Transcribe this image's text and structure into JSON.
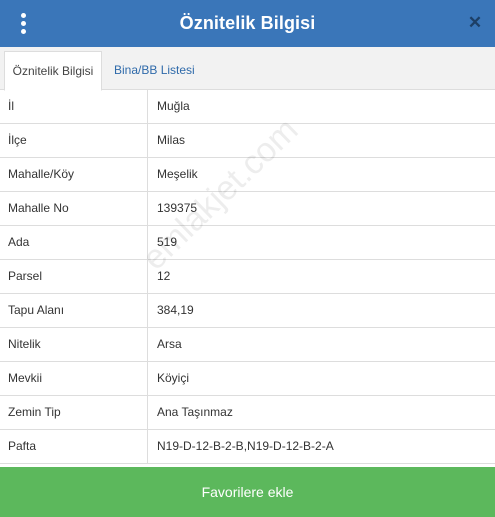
{
  "header": {
    "title": "Öznitelik Bilgisi",
    "close_symbol": "✕"
  },
  "tabs": [
    {
      "label": "Öznitelik Bilgisi",
      "active": true
    },
    {
      "label": "Bina/BB Listesi",
      "active": false
    }
  ],
  "attributes": [
    {
      "label": "İl",
      "value": "Muğla"
    },
    {
      "label": "İlçe",
      "value": "Milas"
    },
    {
      "label": "Mahalle/Köy",
      "value": "Meşelik"
    },
    {
      "label": "Mahalle No",
      "value": "139375"
    },
    {
      "label": "Ada",
      "value": "519"
    },
    {
      "label": "Parsel",
      "value": "12"
    },
    {
      "label": "Tapu Alanı",
      "value": "384,19"
    },
    {
      "label": "Nitelik",
      "value": "Arsa"
    },
    {
      "label": "Mevkii",
      "value": "Köyiçi"
    },
    {
      "label": "Zemin Tip",
      "value": "Ana Taşınmaz"
    },
    {
      "label": "Pafta",
      "value": "N19-D-12-B-2-B,N19-D-12-B-2-A"
    }
  ],
  "watermark": "emlakjet.com",
  "footer": {
    "button_label": "Favorilere ekle"
  },
  "colors": {
    "header": "#3a76b9",
    "footer_button": "#5cb85c",
    "tab_link": "#2f6aaa"
  }
}
